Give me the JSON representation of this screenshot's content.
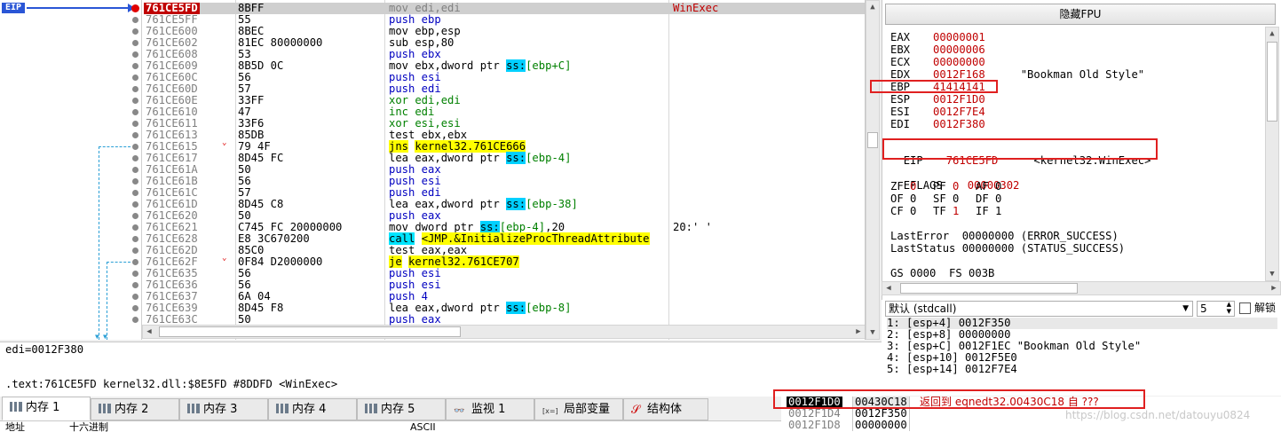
{
  "eip_label": "EIP",
  "disasm": [
    {
      "addr": "761CE5FD",
      "bytes": "8BFF",
      "asm": [
        [
          "mov edi,edi",
          ""
        ]
      ],
      "comment": "WinExec",
      "current": true
    },
    {
      "addr": "761CE5FF",
      "bytes": "55",
      "asm": [
        [
          "push ebp",
          "b"
        ]
      ],
      "comment": ""
    },
    {
      "addr": "761CE600",
      "bytes": "8BEC",
      "asm": [
        [
          "mov ebp,esp",
          ""
        ]
      ],
      "comment": ""
    },
    {
      "addr": "761CE602",
      "bytes": "81EC 80000000",
      "asm": [
        [
          "sub esp,80",
          ""
        ]
      ],
      "comment": ""
    },
    {
      "addr": "761CE608",
      "bytes": "53",
      "asm": [
        [
          "push ebx",
          "b"
        ]
      ],
      "comment": ""
    },
    {
      "addr": "761CE609",
      "bytes": "8B5D 0C",
      "asm": [
        [
          "mov ebx,dword ptr ",
          ""
        ],
        [
          "ss:",
          "s"
        ],
        [
          "[ebp+C]",
          "g"
        ]
      ],
      "comment": ""
    },
    {
      "addr": "761CE60C",
      "bytes": "56",
      "asm": [
        [
          "push esi",
          "b"
        ]
      ],
      "comment": ""
    },
    {
      "addr": "761CE60D",
      "bytes": "57",
      "asm": [
        [
          "push edi",
          "b"
        ]
      ],
      "comment": ""
    },
    {
      "addr": "761CE60E",
      "bytes": "33FF",
      "asm": [
        [
          "xor edi,edi",
          "g"
        ]
      ],
      "comment": ""
    },
    {
      "addr": "761CE610",
      "bytes": "47",
      "asm": [
        [
          "inc edi",
          "g"
        ]
      ],
      "comment": ""
    },
    {
      "addr": "761CE611",
      "bytes": "33F6",
      "asm": [
        [
          "xor esi,esi",
          "g"
        ]
      ],
      "comment": ""
    },
    {
      "addr": "761CE613",
      "bytes": "85DB",
      "asm": [
        [
          "test ebx,ebx",
          ""
        ]
      ],
      "comment": ""
    },
    {
      "addr": "761CE615",
      "bytes": "79 4F",
      "asm": [
        [
          "jns",
          "y"
        ],
        [
          " ",
          ""
        ],
        [
          "kernel32.761CE666",
          "y"
        ]
      ],
      "comment": ""
    },
    {
      "addr": "761CE617",
      "bytes": "8D45 FC",
      "asm": [
        [
          "lea eax,dword ptr ",
          ""
        ],
        [
          "ss:",
          "s"
        ],
        [
          "[ebp-4]",
          "g"
        ]
      ],
      "comment": ""
    },
    {
      "addr": "761CE61A",
      "bytes": "50",
      "asm": [
        [
          "push eax",
          "b"
        ]
      ],
      "comment": ""
    },
    {
      "addr": "761CE61B",
      "bytes": "56",
      "asm": [
        [
          "push esi",
          "b"
        ]
      ],
      "comment": ""
    },
    {
      "addr": "761CE61C",
      "bytes": "57",
      "asm": [
        [
          "push edi",
          "b"
        ]
      ],
      "comment": ""
    },
    {
      "addr": "761CE61D",
      "bytes": "8D45 C8",
      "asm": [
        [
          "lea eax,dword ptr ",
          ""
        ],
        [
          "ss:",
          "s"
        ],
        [
          "[ebp-38]",
          "g"
        ]
      ],
      "comment": ""
    },
    {
      "addr": "761CE620",
      "bytes": "50",
      "asm": [
        [
          "push eax",
          "b"
        ]
      ],
      "comment": ""
    },
    {
      "addr": "761CE621",
      "bytes": "C745 FC 20000000",
      "asm": [
        [
          "mov dword ptr ",
          ""
        ],
        [
          "ss:",
          "s"
        ],
        [
          "[ebp-4]",
          "g"
        ],
        [
          ",20",
          ""
        ]
      ],
      "comment": "20:' '"
    },
    {
      "addr": "761CE628",
      "bytes": "E8 3C670200",
      "asm": [
        [
          "call",
          "c"
        ],
        [
          " ",
          ""
        ],
        [
          "<JMP.&InitializeProcThreadAttribute",
          "y"
        ]
      ],
      "comment": ""
    },
    {
      "addr": "761CE62D",
      "bytes": "85C0",
      "asm": [
        [
          "test eax,eax",
          ""
        ]
      ],
      "comment": ""
    },
    {
      "addr": "761CE62F",
      "bytes": "0F84 D2000000",
      "asm": [
        [
          "je",
          "y"
        ],
        [
          " ",
          ""
        ],
        [
          "kernel32.761CE707",
          "y"
        ]
      ],
      "comment": ""
    },
    {
      "addr": "761CE635",
      "bytes": "56",
      "asm": [
        [
          "push esi",
          "b"
        ]
      ],
      "comment": ""
    },
    {
      "addr": "761CE636",
      "bytes": "56",
      "asm": [
        [
          "push esi",
          "b"
        ]
      ],
      "comment": ""
    },
    {
      "addr": "761CE637",
      "bytes": "6A 04",
      "asm": [
        [
          "push 4",
          "b"
        ]
      ],
      "comment": ""
    },
    {
      "addr": "761CE639",
      "bytes": "8D45 F8",
      "asm": [
        [
          "lea eax,dword ptr ",
          ""
        ],
        [
          "ss:",
          "s"
        ],
        [
          "[ebp-8]",
          "g"
        ]
      ],
      "comment": ""
    },
    {
      "addr": "761CE63C",
      "bytes": "50",
      "asm": [
        [
          "push eax",
          "b"
        ]
      ],
      "comment": ""
    }
  ],
  "fpu_button": "隐藏FPU",
  "registers": [
    {
      "name": "EAX",
      "value": "00000001",
      "extra": ""
    },
    {
      "name": "EBX",
      "value": "00000006",
      "extra": ""
    },
    {
      "name": "ECX",
      "value": "00000000",
      "extra": ""
    },
    {
      "name": "EDX",
      "value": "0012F168",
      "extra": "\"Bookman Old Style\""
    },
    {
      "name": "EBP",
      "value": "41414141",
      "extra": ""
    },
    {
      "name": "ESP",
      "value": "0012F1D0",
      "extra": ""
    },
    {
      "name": "ESI",
      "value": "0012F7E4",
      "extra": ""
    },
    {
      "name": "EDI",
      "value": "0012F380",
      "extra": ""
    }
  ],
  "eip_reg": {
    "name": "EIP",
    "value": "761CE5FD",
    "extra": "<kernel32.WinExec>"
  },
  "eflags": {
    "name": "EFLAGS",
    "value": "00000302"
  },
  "flags": [
    [
      {
        "n": "ZF",
        "v": "0",
        "red": true
      },
      {
        "n": "PF",
        "v": "0",
        "red": true
      },
      {
        "n": "AF",
        "v": "0",
        "red": false
      }
    ],
    [
      {
        "n": "OF",
        "v": "0",
        "red": false
      },
      {
        "n": "SF",
        "v": "0",
        "red": false
      },
      {
        "n": "DF",
        "v": "0",
        "red": false
      }
    ],
    [
      {
        "n": "CF",
        "v": "0",
        "red": false
      },
      {
        "n": "TF",
        "v": "1",
        "red": true
      },
      {
        "n": "IF",
        "v": "1",
        "red": false
      }
    ]
  ],
  "last_error": "LastError  00000000 (ERROR_SUCCESS)",
  "last_status": "LastStatus 00000000 (STATUS_SUCCESS)",
  "segments": "GS 0000  FS 003B",
  "info_line1": "edi=0012F380",
  "info_line2": ".text:761CE5FD kernel32.dll:$8E5FD #8DDFD <WinExec>",
  "call_convention": "默认 (stdcall)",
  "arg_count": "5",
  "unlock_label": "解锁",
  "args": [
    "1: [esp+4] 0012F350",
    "2: [esp+8] 00000000",
    "3: [esp+C] 0012F1EC \"Bookman Old Style\"",
    "4: [esp+10] 0012F5E0",
    "5: [esp+14] 0012F7E4"
  ],
  "tabs": [
    "内存 1",
    "内存 2",
    "内存 3",
    "内存 4",
    "内存 5",
    "监视 1",
    "局部变量",
    "结构体"
  ],
  "hex_headers": [
    "地址",
    "十六进制",
    "ASCII"
  ],
  "stack": [
    {
      "addr": "0012F1D0",
      "val": "00430C18",
      "cmt": "返回到 eqnedt32.00430C18 自 ???",
      "cur": true
    },
    {
      "addr": "0012F1D4",
      "val": "0012F350",
      "cmt": "",
      "cur": false
    },
    {
      "addr": "0012F1D8",
      "val": "00000000",
      "cmt": "",
      "cur": false
    }
  ],
  "watermark": "https://blog.csdn.net/datouyu0824"
}
